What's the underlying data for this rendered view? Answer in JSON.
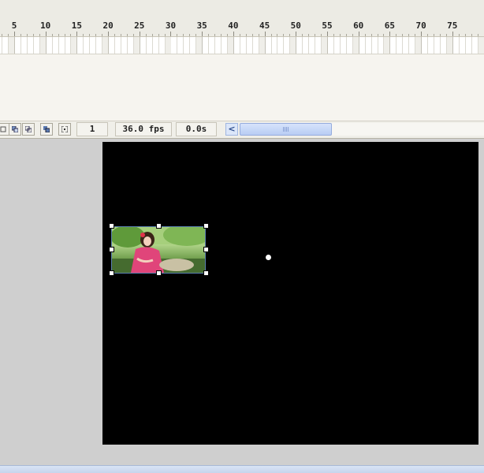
{
  "timeline": {
    "ruler_labels": [
      "5",
      "10",
      "15",
      "20",
      "25",
      "30",
      "35",
      "40",
      "45",
      "50",
      "55",
      "60",
      "65",
      "70",
      "75"
    ],
    "status": {
      "current_frame": "1",
      "frame_rate": "36.0 fps",
      "elapsed_time": "0.0s"
    },
    "buttons": [
      {
        "name": "center-frame-icon"
      },
      {
        "name": "onion-skin-icon"
      },
      {
        "name": "onion-skin-outlines-icon"
      },
      {
        "name": "edit-multiple-frames-icon"
      },
      {
        "name": "modify-onion-markers-icon"
      }
    ],
    "scrollbar": {
      "left_arrow": "<"
    }
  },
  "stage": {
    "background": "#000000",
    "selected_object": {
      "type": "bitmap",
      "description_icon": "photo-thumbnail"
    }
  },
  "colors": {
    "panel_bg": "#ecebe4",
    "work_area_bg": "#cfcfcf",
    "stage_bg": "#000000",
    "scroll_thumb": "#b9cdf4"
  }
}
